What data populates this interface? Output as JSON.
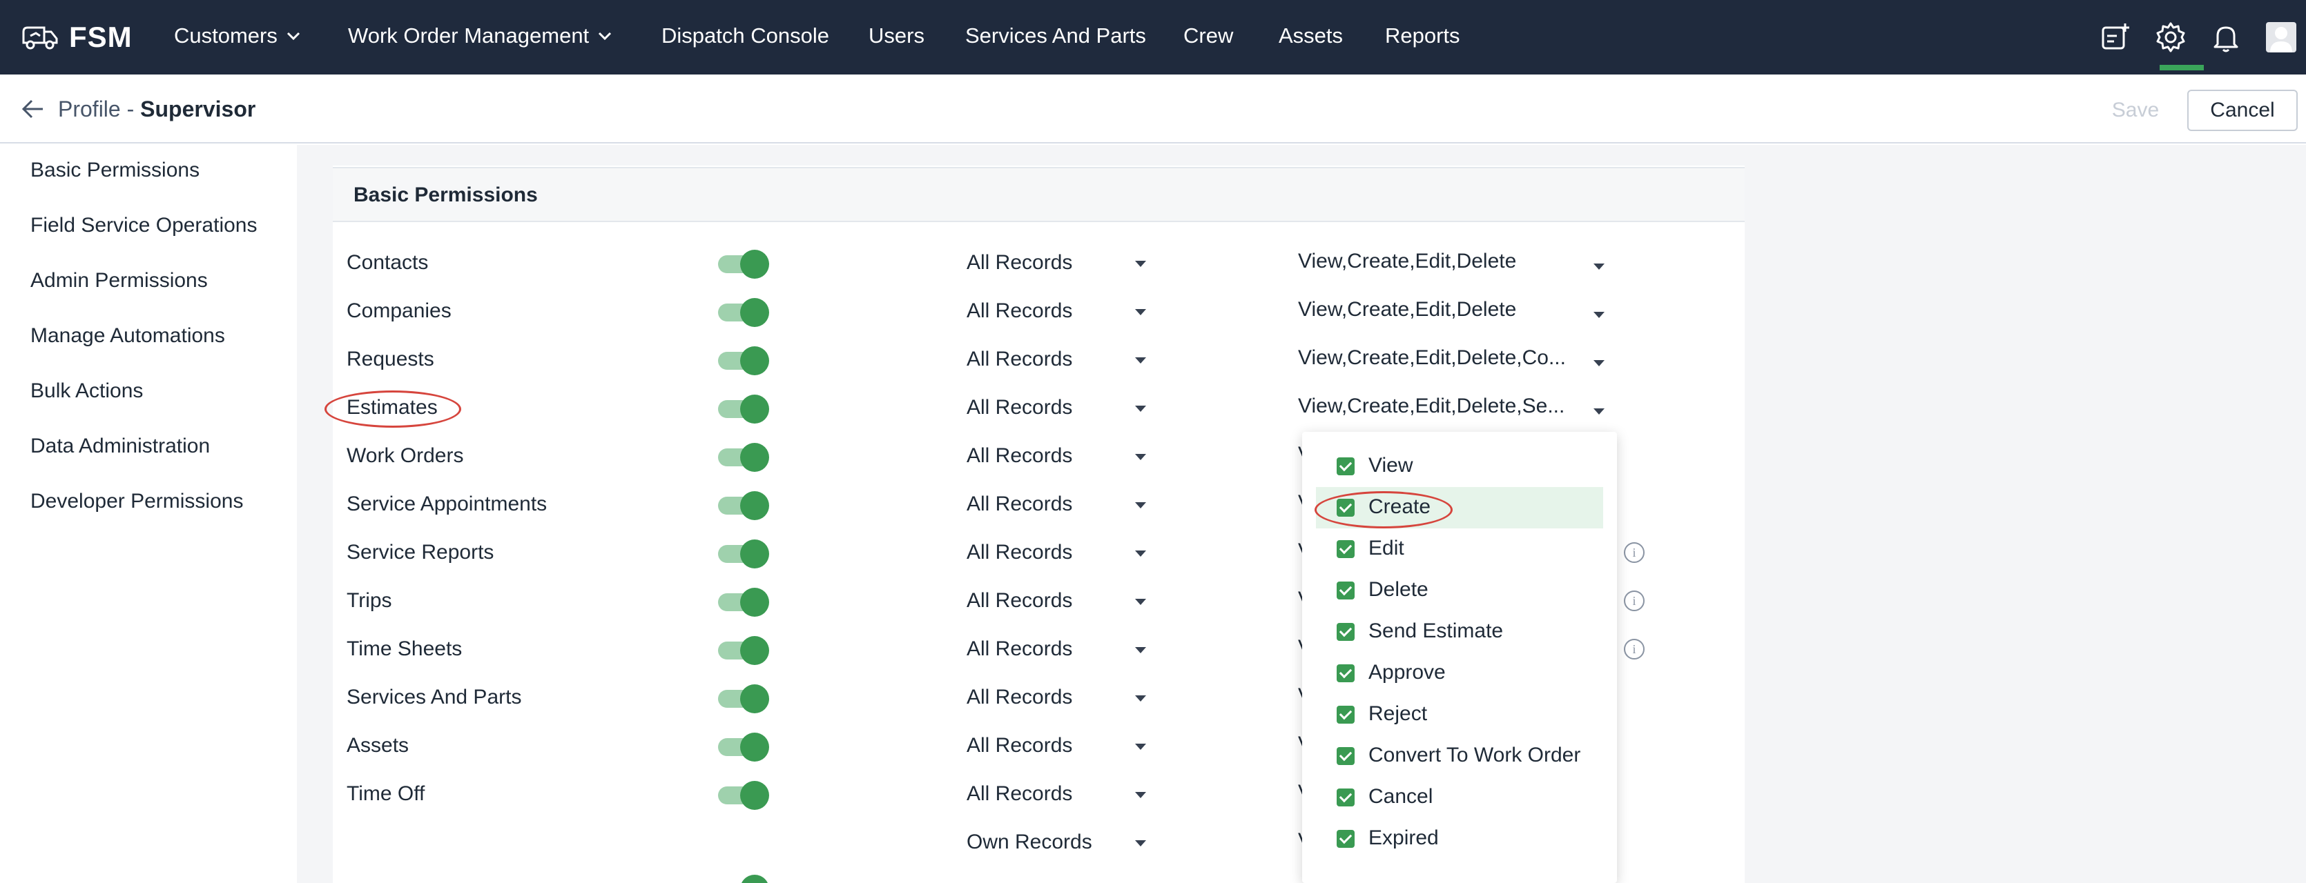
{
  "app": {
    "brand": "FSM"
  },
  "nav": {
    "items": [
      {
        "label": "Customers",
        "has_menu": true
      },
      {
        "label": "Work Order Management",
        "has_menu": true
      },
      {
        "label": "Dispatch Console",
        "has_menu": false
      },
      {
        "label": "Users",
        "has_menu": false
      },
      {
        "label": "Services And Parts",
        "has_menu": false
      },
      {
        "label": "Crew",
        "has_menu": false
      },
      {
        "label": "Assets",
        "has_menu": false
      },
      {
        "label": "Reports",
        "has_menu": false
      }
    ],
    "icons": [
      "add-form-icon",
      "gear-icon",
      "bell-icon",
      "avatar-icon"
    ],
    "accent": "#3aa55a"
  },
  "header": {
    "crumb_prefix": "Profile - ",
    "crumb_name": "Supervisor",
    "save_label": "Save",
    "cancel_label": "Cancel"
  },
  "sidebar": {
    "items": [
      "Basic Permissions",
      "Field Service Operations",
      "Admin Permissions",
      "Manage Automations",
      "Bulk Actions",
      "Data Administration",
      "Developer Permissions"
    ]
  },
  "section": {
    "title": "Basic Permissions"
  },
  "rows": [
    {
      "module": "Contacts",
      "enabled": true,
      "scope": "All Records",
      "permissions": "View,Create,Edit,Delete"
    },
    {
      "module": "Companies",
      "enabled": true,
      "scope": "All Records",
      "permissions": "View,Create,Edit,Delete"
    },
    {
      "module": "Requests",
      "enabled": true,
      "scope": "All Records",
      "permissions": "View,Create,Edit,Delete,Co..."
    },
    {
      "module": "Estimates",
      "enabled": true,
      "scope": "All Records",
      "permissions": "View,Create,Edit,Delete,Se..."
    },
    {
      "module": "Work Orders",
      "enabled": true,
      "scope": "All Records",
      "permissions": "V"
    },
    {
      "module": "Service Appointments",
      "enabled": true,
      "scope": "All Records",
      "permissions": "V"
    },
    {
      "module": "Service Reports",
      "enabled": true,
      "scope": "All Records",
      "permissions": "V"
    },
    {
      "module": "Trips",
      "enabled": true,
      "scope": "All Records",
      "permissions": "V"
    },
    {
      "module": "Time Sheets",
      "enabled": true,
      "scope": "All Records",
      "permissions": "V"
    },
    {
      "module": "Services And Parts",
      "enabled": true,
      "scope": "All Records",
      "permissions": "V"
    },
    {
      "module": "Assets",
      "enabled": true,
      "scope": "All Records",
      "permissions": "V"
    },
    {
      "module": "Time Off",
      "enabled": true,
      "scope": "All Records",
      "permissions": "V"
    },
    {
      "module": "",
      "enabled": null,
      "scope": "Own Records",
      "permissions": "V"
    }
  ],
  "dropdown": {
    "options": [
      {
        "label": "View",
        "checked": true
      },
      {
        "label": "Create",
        "checked": true,
        "highlighted": true
      },
      {
        "label": "Edit",
        "checked": true
      },
      {
        "label": "Delete",
        "checked": true
      },
      {
        "label": "Send Estimate",
        "checked": true
      },
      {
        "label": "Approve",
        "checked": true
      },
      {
        "label": "Reject",
        "checked": true
      },
      {
        "label": "Convert To Work Order",
        "checked": true
      },
      {
        "label": "Cancel",
        "checked": true
      },
      {
        "label": "Expired",
        "checked": true
      }
    ]
  },
  "colors": {
    "nav_bg": "#1f2a3d",
    "toggle_on": "#3a9a52",
    "annotation": "#d6453d"
  }
}
